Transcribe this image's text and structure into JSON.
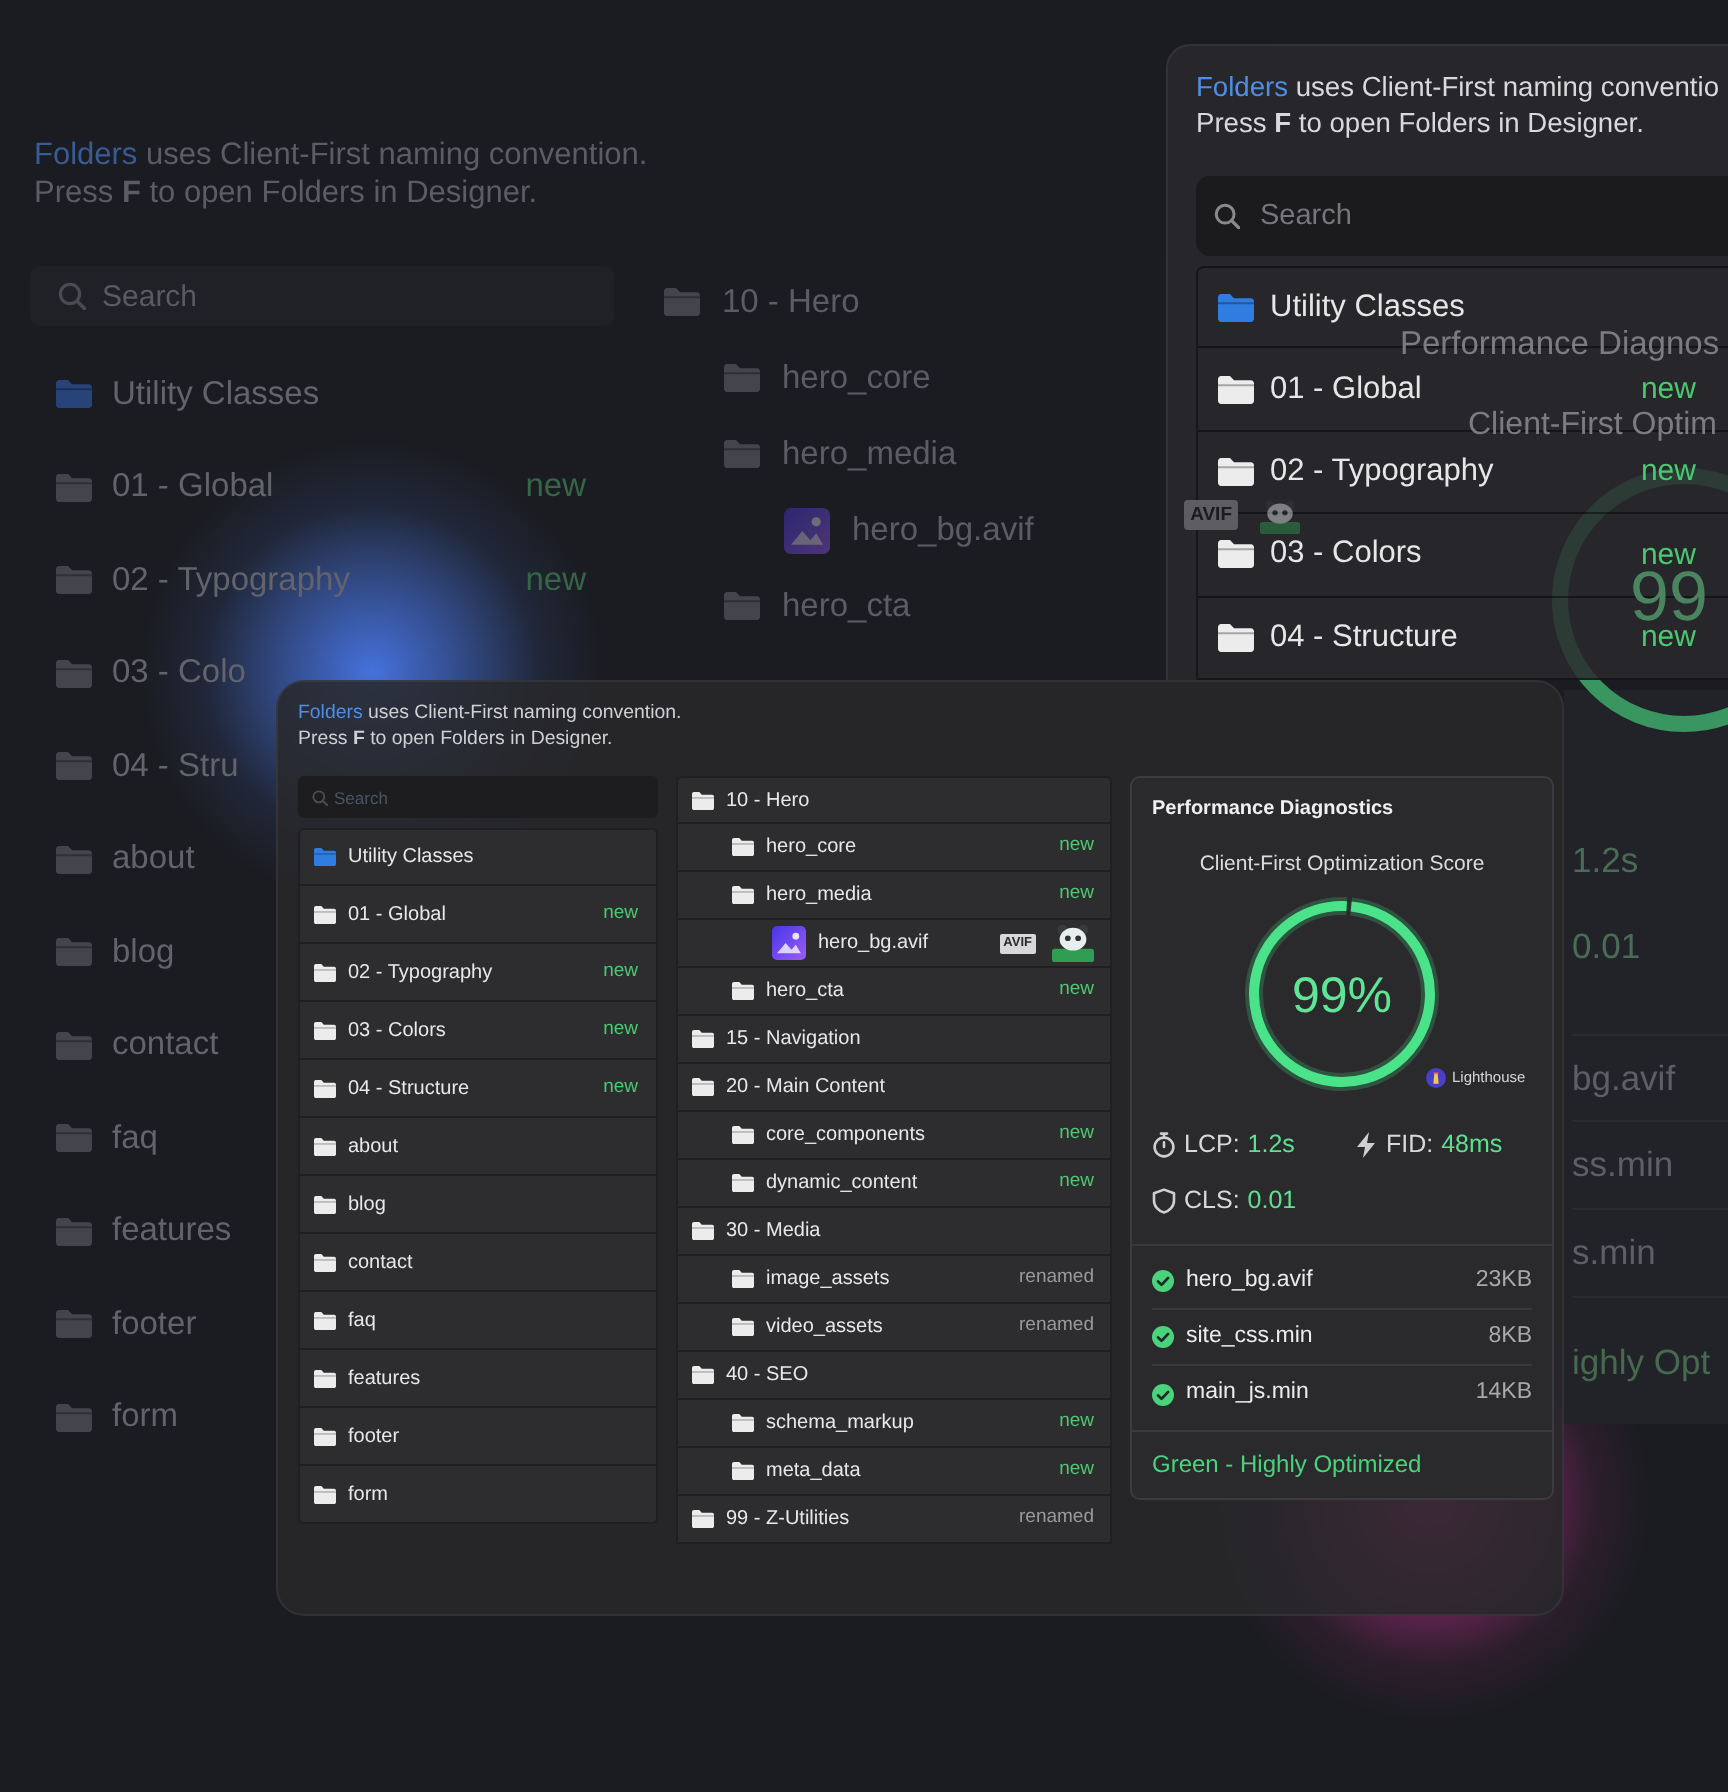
{
  "backdrop": {
    "intro": {
      "link": "Folders",
      "text": "uses Client-First naming convention.",
      "hint": "Press **F** to open Folders in Designer."
    },
    "search": {
      "placeholder": "Search"
    },
    "folders": [
      {
        "name": "Utility Classes",
        "kind": "utility"
      },
      {
        "name": "01 - Global",
        "kind": "folder",
        "tag": {
          "text": "new",
          "color": "#356645"
        }
      },
      {
        "name": "02 - Typography",
        "kind": "folder",
        "tag": {
          "text": "new",
          "color": "#356645"
        }
      },
      {
        "name": "03 - Colo",
        "kind": "folder"
      },
      {
        "name": "04 - Stru",
        "kind": "folder"
      },
      {
        "name": "about",
        "kind": "folder"
      },
      {
        "name": "blog",
        "kind": "folder"
      },
      {
        "name": "contact",
        "kind": "folder"
      },
      {
        "name": "faq",
        "kind": "folder"
      },
      {
        "name": "features",
        "kind": "folder"
      },
      {
        "name": "footer",
        "kind": "folder"
      },
      {
        "name": "form",
        "kind": "folder"
      }
    ],
    "tree": [
      {
        "name": "10 - Hero",
        "kind": "folder",
        "children": [
          {
            "name": "hero_core",
            "kind": "folder"
          },
          {
            "name": "hero_media",
            "kind": "folder",
            "children": [
              {
                "name": "hero_bg.avif",
                "kind": "image",
                "badge": "AVIF",
                "compressed": true
              }
            ]
          },
          {
            "name": "hero_cta",
            "kind": "folder"
          }
        ]
      }
    ],
    "diagnostics": {
      "title": "Performance Diagnos",
      "subtitle": "Client-First Optim",
      "score": "99",
      "metric_values": [
        "1.2s",
        "0.01"
      ],
      "files": [
        "bg.avif",
        "ss.min",
        "s.min"
      ],
      "status": "ighly Opt"
    }
  },
  "folders_panel": {
    "intro": {
      "link": "Folders",
      "text": "uses Client-First naming conventio",
      "hint": "Press **F** to open Folders in Designer."
    },
    "search": {
      "placeholder": "Search"
    },
    "folders": [
      {
        "name": "Utility Classes",
        "kind": "utility"
      },
      {
        "name": "01 - Global",
        "kind": "folder",
        "tag": {
          "text": "new",
          "color": "#4ac96f"
        }
      },
      {
        "name": "02 - Typography",
        "kind": "folder",
        "tag": {
          "text": "new",
          "color": "#4ac96f"
        }
      },
      {
        "name": "03 - Colors",
        "kind": "folder",
        "tag": {
          "text": "new",
          "color": "#4ac96f"
        }
      },
      {
        "name": "04 - Structure",
        "kind": "folder",
        "tag": {
          "text": "new",
          "color": "#4ac96f"
        }
      }
    ]
  },
  "main_panel": {
    "intro": {
      "link": "Folders",
      "text": "uses Client-First naming convention.",
      "hint": "Press **F** to open Folders in Designer."
    },
    "search": {
      "placeholder": "Search"
    },
    "folders": [
      {
        "name": "Utility Classes",
        "kind": "utility"
      },
      {
        "name": "01 - Global",
        "kind": "folder",
        "tag": {
          "text": "new",
          "color": "#4ac96f"
        }
      },
      {
        "name": "02 - Typography",
        "kind": "folder",
        "tag": {
          "text": "new",
          "color": "#4ac96f"
        }
      },
      {
        "name": "03 - Colors",
        "kind": "folder",
        "tag": {
          "text": "new",
          "color": "#4ac96f"
        }
      },
      {
        "name": "04 - Structure",
        "kind": "folder",
        "tag": {
          "text": "new",
          "color": "#4ac96f"
        }
      },
      {
        "name": "about",
        "kind": "folder"
      },
      {
        "name": "blog",
        "kind": "folder"
      },
      {
        "name": "contact",
        "kind": "folder"
      },
      {
        "name": "faq",
        "kind": "folder"
      },
      {
        "name": "features",
        "kind": "folder"
      },
      {
        "name": "footer",
        "kind": "folder"
      },
      {
        "name": "form",
        "kind": "folder"
      }
    ],
    "tree": [
      {
        "name": "10 - Hero",
        "kind": "folder",
        "children": [
          {
            "name": "hero_core",
            "kind": "folder",
            "tag": {
              "text": "new",
              "color": "#4ac96f"
            }
          },
          {
            "name": "hero_media",
            "kind": "folder",
            "tag": {
              "text": "new",
              "color": "#4ac96f"
            },
            "children": [
              {
                "name": "hero_bg.avif",
                "kind": "image",
                "badge": "AVIF",
                "compressed": true
              }
            ]
          },
          {
            "name": "hero_cta",
            "kind": "folder",
            "tag": {
              "text": "new",
              "color": "#4ac96f"
            }
          }
        ]
      },
      {
        "name": "15 - Navigation",
        "kind": "folder"
      },
      {
        "name": "20 - Main Content",
        "kind": "folder",
        "children": [
          {
            "name": "core_components",
            "kind": "folder",
            "tag": {
              "text": "new",
              "color": "#4ac96f"
            }
          },
          {
            "name": "dynamic_content",
            "kind": "folder",
            "tag": {
              "text": "new",
              "color": "#4ac96f"
            }
          }
        ]
      },
      {
        "name": "30 - Media",
        "kind": "folder",
        "children": [
          {
            "name": "image_assets",
            "kind": "folder",
            "tag": {
              "text": "renamed",
              "color": "#9a9a9d"
            }
          },
          {
            "name": "video_assets",
            "kind": "folder",
            "tag": {
              "text": "renamed",
              "color": "#9a9a9d"
            }
          }
        ]
      },
      {
        "name": "40 - SEO",
        "kind": "folder",
        "children": [
          {
            "name": "schema_markup",
            "kind": "folder",
            "tag": {
              "text": "new",
              "color": "#4ac96f"
            }
          },
          {
            "name": "meta_data",
            "kind": "folder",
            "tag": {
              "text": "new",
              "color": "#4ac96f"
            }
          }
        ]
      },
      {
        "name": "99 - Z-Utilities",
        "kind": "folder",
        "tag": {
          "text": "renamed",
          "color": "#9a9a9d"
        }
      }
    ],
    "diagnostics": {
      "title": "Performance Diagnostics",
      "subtitle": "Client-First Optimization Score",
      "score": {
        "text": "99%",
        "level": 0.99
      },
      "source": "Lighthouse",
      "metrics": [
        {
          "kind": "timer",
          "label": "LCP:",
          "value": "1.2s"
        },
        {
          "kind": "bolt",
          "label": "FID:",
          "value": "48ms"
        },
        {
          "kind": "shield",
          "label": "CLS:",
          "value": "0.01"
        }
      ],
      "files": [
        {
          "name": "hero_bg.avif",
          "size": "23KB",
          "checked": true
        },
        {
          "name": "site_css.min",
          "size": "8KB",
          "checked": true
        },
        {
          "name": "main_js.min",
          "size": "14KB",
          "checked": true
        }
      ],
      "status": "Green - Highly Optimized"
    }
  }
}
